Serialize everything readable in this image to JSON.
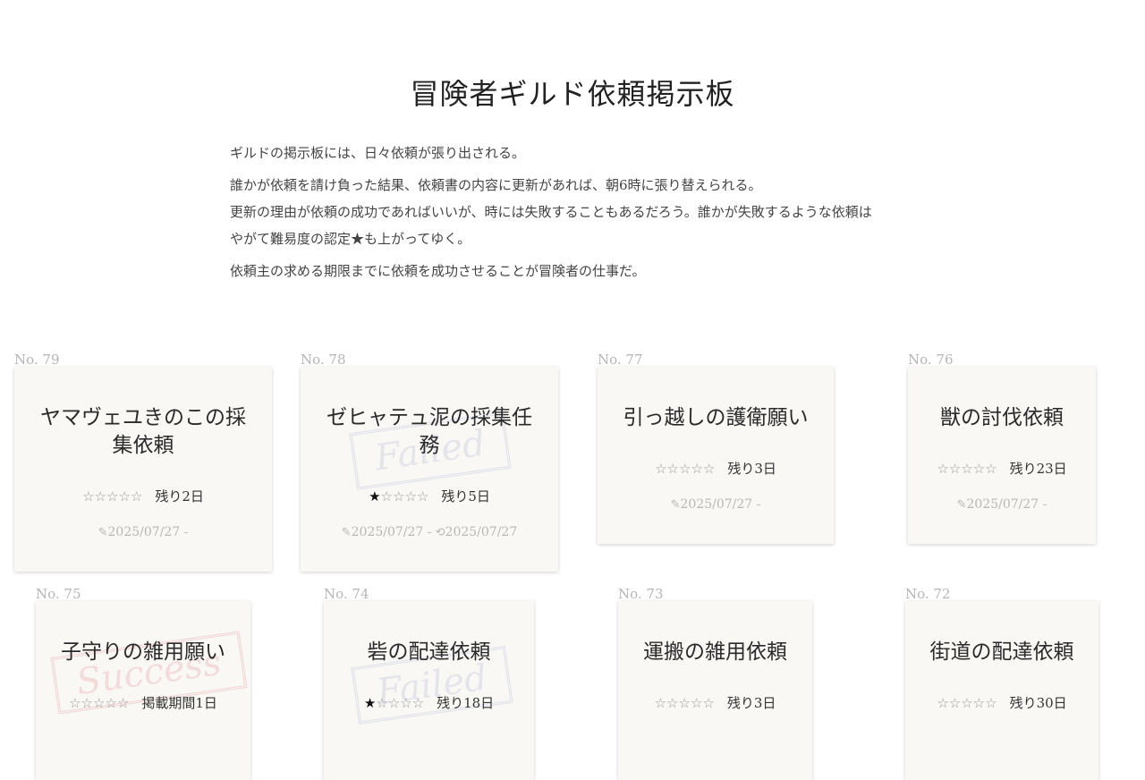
{
  "header": {
    "title": "冒険者ギルド依頼掲示板",
    "intro": [
      "ギルドの掲示板には、日々依頼が張り出される。",
      "誰かが依頼を請け負った結果、依頼書の内容に更新があれば、朝6時に張り替えられる。",
      "更新の理由が依頼の成功であればいいが、時には失敗することもあるだろう。誰かが失敗するような依頼は",
      "やがて難易度の認定★も上がってゆく。",
      "依頼主の求める期限までに依頼を成功させることが冒険者の仕事だ。"
    ]
  },
  "icons": {
    "star_filled": "★",
    "star_empty": "☆",
    "edit": "pencil-icon",
    "history": "history-icon"
  },
  "quests": [
    {
      "no": "No. 79",
      "title": "ヤマヴェユきのこの採集依頼",
      "stars": 0,
      "remaining": "残り2日",
      "posted": "2025/07/27 -",
      "updated": "",
      "stamp": ""
    },
    {
      "no": "No. 78",
      "title": "ゼヒャテュ泥の採集任務",
      "stars": 1,
      "remaining": "残り5日",
      "posted": "2025/07/27 -",
      "updated": "2025/07/27",
      "stamp": "Failed"
    },
    {
      "no": "No. 77",
      "title": "引っ越しの護衛願い",
      "stars": 0,
      "remaining": "残り3日",
      "posted": "2025/07/27 -",
      "updated": "",
      "stamp": ""
    },
    {
      "no": "No. 76",
      "title": "獣の討伐依頼",
      "stars": 0,
      "remaining": "残り23日",
      "posted": "2025/07/27 -",
      "updated": "",
      "stamp": ""
    },
    {
      "no": "No. 75",
      "title": "子守りの雑用願い",
      "stars": 0,
      "remaining": "掲載期間1日",
      "posted": "",
      "updated": "",
      "stamp": "Success"
    },
    {
      "no": "No. 74",
      "title": "砦の配達依頼",
      "stars": 1,
      "remaining": "残り18日",
      "posted": "",
      "updated": "",
      "stamp": "Failed"
    },
    {
      "no": "No. 73",
      "title": "運搬の雑用依頼",
      "stars": 0,
      "remaining": "残り3日",
      "posted": "",
      "updated": "",
      "stamp": ""
    },
    {
      "no": "No. 72",
      "title": "街道の配達依頼",
      "stars": 0,
      "remaining": "残り30日",
      "posted": "",
      "updated": "",
      "stamp": ""
    }
  ]
}
